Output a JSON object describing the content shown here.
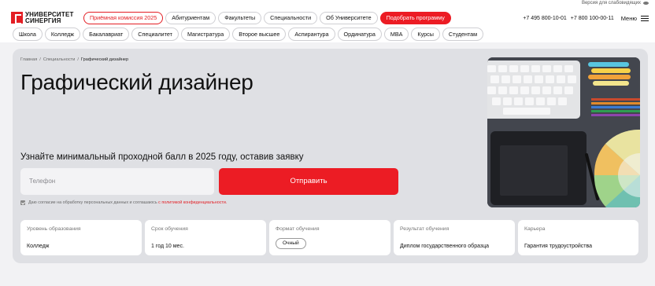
{
  "topbar": {
    "vision_label": "Версия для слабовидящих"
  },
  "brand": {
    "line1": "УНИВЕРСИТЕТ",
    "line2": "СИНЕРГИЯ"
  },
  "nav_primary": [
    {
      "label": "Приёмная комиссия 2025",
      "style": "red-outline"
    },
    {
      "label": "Абитуриентам",
      "style": "default"
    },
    {
      "label": "Факультеты",
      "style": "default"
    },
    {
      "label": "Специальности",
      "style": "default"
    },
    {
      "label": "Об Университете",
      "style": "default"
    },
    {
      "label": "Подобрать программу",
      "style": "red"
    }
  ],
  "contacts": {
    "phone1": "+7 495 800-10-01",
    "phone2": "+7 800 100-00-11",
    "menu_label": "Меню"
  },
  "nav_secondary": [
    "Школа",
    "Колледж",
    "Бакалавриат",
    "Специалитет",
    "Магистратура",
    "Второе высшее",
    "Аспирантура",
    "Ординатура",
    "MBA",
    "Курсы",
    "Студентам"
  ],
  "breadcrumb": {
    "home": "Главная",
    "sep": "/",
    "section": "Специальности",
    "current": "Графический дизайнер"
  },
  "hero": {
    "title": "Графический дизайнер",
    "lead": "Узнайте минимальный проходной балл в 2025 году, оставив заявку",
    "phone_placeholder": "Телефон",
    "submit_label": "Отправить",
    "consent_text": "Даю согласие на обработку персональных данных и соглашаюсь",
    "consent_link": "с политикой конфиденциальности."
  },
  "info_cards": [
    {
      "label": "Уровень образования",
      "value": "Колледж"
    },
    {
      "label": "Срок обучения",
      "value": "1 год 10 мес."
    },
    {
      "label": "Формат обучения",
      "value": "Очный",
      "chip": true
    },
    {
      "label": "Результат обучения",
      "value": "Диплом государственного образца"
    },
    {
      "label": "Карьера",
      "value": "Гарантия трудоустройства"
    }
  ],
  "colors": {
    "brand_red": "#ec1c24",
    "hero_bg": "#dfe0e4",
    "page_bg": "#f2f2f4"
  },
  "icons": [
    "eye-icon",
    "logo-icon",
    "burger-menu-icon",
    "checkbox-icon"
  ]
}
